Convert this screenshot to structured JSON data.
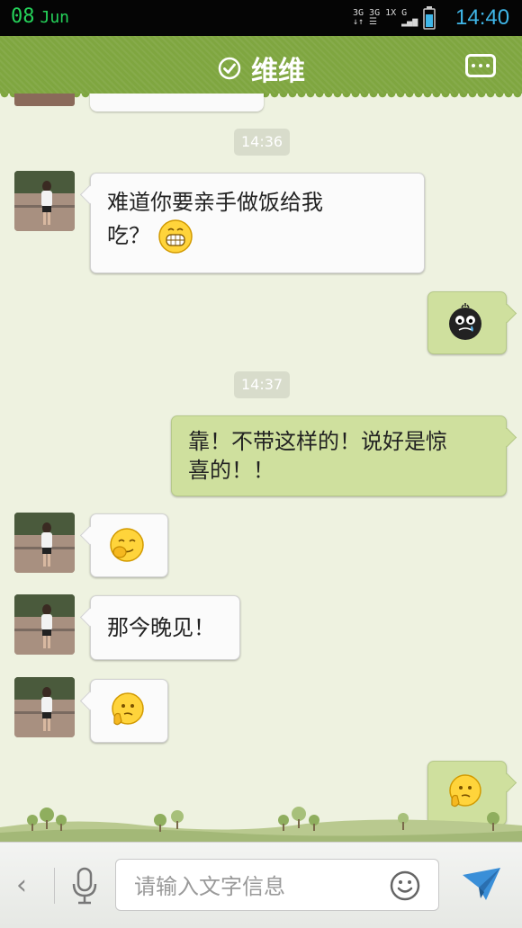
{
  "status_bar": {
    "day": "08",
    "month": "Jun",
    "network_left": "3G",
    "network_right": "3G 1X",
    "signal_label": "G",
    "time": "14:40",
    "time_color": "#3fb6e8"
  },
  "header": {
    "title": "维维",
    "verified_icon": "check-circle-icon",
    "menu_icon": "more-dots-icon",
    "bg_color": "#7fa640"
  },
  "messages": [
    {
      "type": "timestamp",
      "text": "14:36"
    },
    {
      "type": "incoming",
      "text_line1": "难道你要亲手做饭给我",
      "text_line2": "吃？",
      "emoji": "grin-emoji"
    },
    {
      "type": "outgoing",
      "emoji": "crying-bomb-emoji"
    },
    {
      "type": "timestamp",
      "text": "14:37"
    },
    {
      "type": "outgoing",
      "text_line1": "靠！不带这样的！说好是惊",
      "text_line2": "喜的！！"
    },
    {
      "type": "incoming",
      "emoji": "shy-smile-emoji"
    },
    {
      "type": "incoming",
      "text": "那今晚见！"
    },
    {
      "type": "incoming",
      "emoji": "thinking-emoji"
    },
    {
      "type": "outgoing",
      "emoji": "thinking-emoji"
    }
  ],
  "input_bar": {
    "placeholder": "请输入文字信息",
    "back_icon": "chevron-left-icon",
    "voice_icon": "microphone-icon",
    "emoji_icon": "smiley-icon",
    "send_icon": "paper-plane-icon"
  }
}
